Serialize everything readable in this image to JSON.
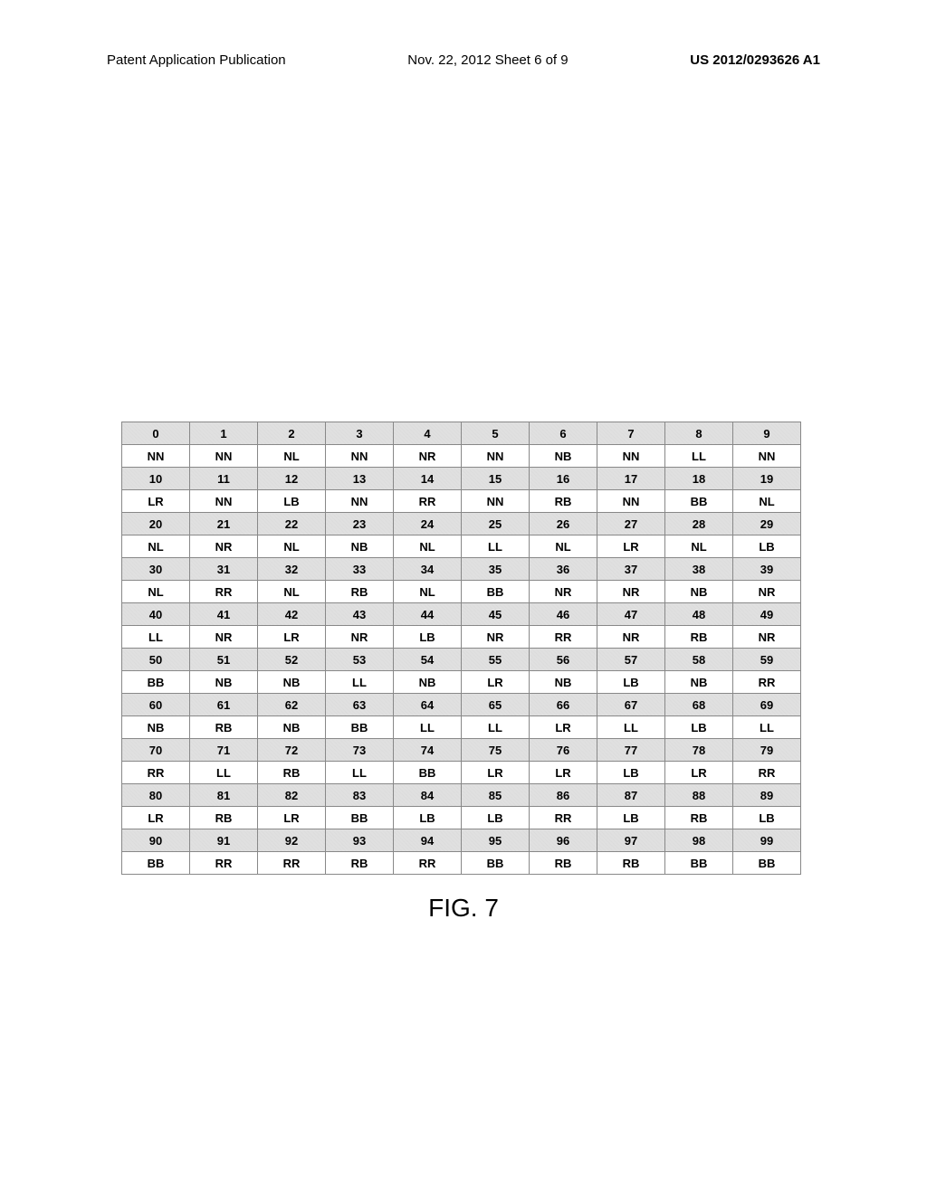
{
  "header": {
    "left": "Patent Application Publication",
    "center": "Nov. 22, 2012  Sheet 6 of 9",
    "right": "US 2012/0293626 A1"
  },
  "chart_data": {
    "type": "table",
    "title": "FIG. 7",
    "rows": [
      {
        "indices": [
          "0",
          "1",
          "2",
          "3",
          "4",
          "5",
          "6",
          "7",
          "8",
          "9"
        ],
        "values": [
          "NN",
          "NN",
          "NL",
          "NN",
          "NR",
          "NN",
          "NB",
          "NN",
          "LL",
          "NN"
        ]
      },
      {
        "indices": [
          "10",
          "11",
          "12",
          "13",
          "14",
          "15",
          "16",
          "17",
          "18",
          "19"
        ],
        "values": [
          "LR",
          "NN",
          "LB",
          "NN",
          "RR",
          "NN",
          "RB",
          "NN",
          "BB",
          "NL"
        ]
      },
      {
        "indices": [
          "20",
          "21",
          "22",
          "23",
          "24",
          "25",
          "26",
          "27",
          "28",
          "29"
        ],
        "values": [
          "NL",
          "NR",
          "NL",
          "NB",
          "NL",
          "LL",
          "NL",
          "LR",
          "NL",
          "LB"
        ]
      },
      {
        "indices": [
          "30",
          "31",
          "32",
          "33",
          "34",
          "35",
          "36",
          "37",
          "38",
          "39"
        ],
        "values": [
          "NL",
          "RR",
          "NL",
          "RB",
          "NL",
          "BB",
          "NR",
          "NR",
          "NB",
          "NR"
        ]
      },
      {
        "indices": [
          "40",
          "41",
          "42",
          "43",
          "44",
          "45",
          "46",
          "47",
          "48",
          "49"
        ],
        "values": [
          "LL",
          "NR",
          "LR",
          "NR",
          "LB",
          "NR",
          "RR",
          "NR",
          "RB",
          "NR"
        ]
      },
      {
        "indices": [
          "50",
          "51",
          "52",
          "53",
          "54",
          "55",
          "56",
          "57",
          "58",
          "59"
        ],
        "values": [
          "BB",
          "NB",
          "NB",
          "LL",
          "NB",
          "LR",
          "NB",
          "LB",
          "NB",
          "RR"
        ]
      },
      {
        "indices": [
          "60",
          "61",
          "62",
          "63",
          "64",
          "65",
          "66",
          "67",
          "68",
          "69"
        ],
        "values": [
          "NB",
          "RB",
          "NB",
          "BB",
          "LL",
          "LL",
          "LR",
          "LL",
          "LB",
          "LL"
        ]
      },
      {
        "indices": [
          "70",
          "71",
          "72",
          "73",
          "74",
          "75",
          "76",
          "77",
          "78",
          "79"
        ],
        "values": [
          "RR",
          "LL",
          "RB",
          "LL",
          "BB",
          "LR",
          "LR",
          "LB",
          "LR",
          "RR"
        ]
      },
      {
        "indices": [
          "80",
          "81",
          "82",
          "83",
          "84",
          "85",
          "86",
          "87",
          "88",
          "89"
        ],
        "values": [
          "LR",
          "RB",
          "LR",
          "BB",
          "LB",
          "LB",
          "RR",
          "LB",
          "RB",
          "LB"
        ]
      },
      {
        "indices": [
          "90",
          "91",
          "92",
          "93",
          "94",
          "95",
          "96",
          "97",
          "98",
          "99"
        ],
        "values": [
          "BB",
          "RR",
          "RR",
          "RB",
          "RR",
          "BB",
          "RB",
          "RB",
          "BB",
          "BB"
        ]
      }
    ]
  },
  "figure_caption": "FIG. 7"
}
